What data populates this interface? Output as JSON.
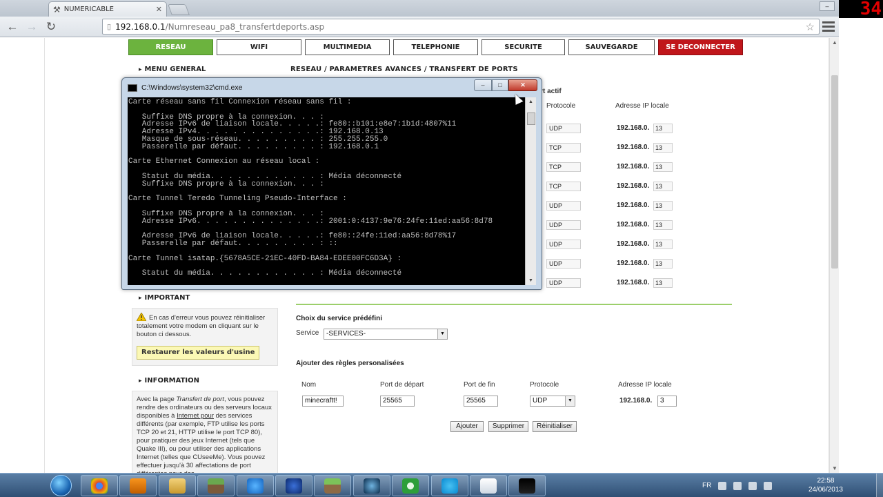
{
  "browser": {
    "tab_title": "NUMERICABLE",
    "url_host": "192.168.0.1",
    "url_path": "/Numreseau_pa8_transfertdeports.asp",
    "recording_counter": "34"
  },
  "router": {
    "nav": [
      {
        "label": "RESEAU",
        "state": "active"
      },
      {
        "label": "WIFI",
        "state": "normal"
      },
      {
        "label": "MULTIMEDIA",
        "state": "normal"
      },
      {
        "label": "TELEPHONIE",
        "state": "normal"
      },
      {
        "label": "SECURITE",
        "state": "normal"
      },
      {
        "label": "SAUVEGARDE",
        "state": "normal"
      },
      {
        "label": "SE DECONNECTER",
        "state": "danger"
      }
    ],
    "sidebar": {
      "menu_general": "MENU GENERAL",
      "important": "IMPORTANT",
      "important_text": "En cas d'erreur vous pouvez réinitialiser totalement votre modem en cliquant sur le bouton ci dessous.",
      "restore_button": "Restaurer les valeurs d'usine",
      "information": "INFORMATION",
      "information_text_1": "Avec la page",
      "information_text_em": "Transfert de port",
      "information_text_2": ", vous pouvez rendre des ordinateurs ou des serveurs locaux disponibles à",
      "information_link": "Internet pour",
      "information_text_3": "des services différents (par exemple, FTP utilise les ports TCP 20 et 21, HTTP utilise le port TCP 80), pour pratiquer des jeux Internet (tels que Quake III), ou pour utiliser des applications Internet (telles que CUseeMe). Vous pouvez effectuer jusqu'à 30 affectations de port différentes pour des"
    },
    "breadcrumb": "RESEAU / PARAMETRES AVANCES / TRANSFERT DE PORTS",
    "rules_table": {
      "partial_header": "ort actif",
      "col_protocol": "Protocole",
      "col_ip": "Adresse IP locale",
      "ip_prefix": "192.168.0.",
      "rows": [
        {
          "protocol": "UDP",
          "ip_suffix": "13"
        },
        {
          "protocol": "TCP",
          "ip_suffix": "13"
        },
        {
          "protocol": "TCP",
          "ip_suffix": "13"
        },
        {
          "protocol": "TCP",
          "ip_suffix": "13"
        },
        {
          "protocol": "UDP",
          "ip_suffix": "13"
        },
        {
          "protocol": "UDP",
          "ip_suffix": "13"
        },
        {
          "protocol": "UDP",
          "ip_suffix": "13"
        },
        {
          "protocol": "UDP",
          "ip_suffix": "13"
        },
        {
          "protocol": "UDP",
          "ip_suffix": "13"
        }
      ]
    },
    "predefined": {
      "title": "Choix du service prédéfini",
      "service_label": "Service",
      "service_value": "-SERVICES-"
    },
    "custom": {
      "title": "Ajouter des règles personalisées",
      "col_name": "Nom",
      "col_start": "Port de départ",
      "col_end": "Port de fin",
      "col_protocol": "Protocole",
      "col_ip": "Adresse IP locale",
      "name_value": "minecraftt!",
      "start_value": "25565",
      "end_value": "25565",
      "protocol_value": "UDP",
      "ip_prefix": "192.168.0.",
      "ip_suffix": "3",
      "btn_add": "Ajouter",
      "btn_delete": "Supprimer",
      "btn_reset": "Réinitialiser"
    }
  },
  "cmd": {
    "title": "C:\\Windows\\system32\\cmd.exe",
    "lines": [
      "Carte réseau sans fil Connexion réseau sans fil :",
      "",
      "   Suffixe DNS propre à la connexion. . . :",
      "   Adresse IPv6 de liaison locale. . . . .: fe80::b101:e8e7:1b1d:4807%11",
      "   Adresse IPv4. . . . . . . . . . . . . .: 192.168.0.13",
      "   Masque de sous-réseau. . . . . . . . . : 255.255.255.0",
      "   Passerelle par défaut. . . . . . . . . : 192.168.0.1",
      "",
      "Carte Ethernet Connexion au réseau local :",
      "",
      "   Statut du média. . . . . . . . . . . . : Média déconnecté",
      "   Suffixe DNS propre à la connexion. . . :",
      "",
      "Carte Tunnel Teredo Tunneling Pseudo-Interface :",
      "",
      "   Suffixe DNS propre à la connexion. . . :",
      "   Adresse IPv6. . . . . . . . . . . . . .: 2001:0:4137:9e76:24fe:11ed:aa56:8d78",
      "",
      "   Adresse IPv6 de liaison locale. . . . .: fe80::24fe:11ed:aa56:8d78%17",
      "   Passerelle par défaut. . . . . . . . . : ::",
      "",
      "Carte Tunnel isatap.{5678A5CE-21EC-40FD-BA84-EDEE00FC6D3A} :",
      "",
      "   Statut du média. . . . . . . . . . . . : Média déconnecté"
    ]
  },
  "taskbar": {
    "language": "FR",
    "time": "22:58",
    "date": "24/06/2013",
    "items": [
      "chrome",
      "media-player",
      "file-explorer",
      "minecraft",
      "internet-explorer",
      "firefox-nightly",
      "minecraft-launcher",
      "steam",
      "utorrent",
      "skype",
      "notepad",
      "cmd"
    ]
  },
  "colors": {
    "nav_active": "#6cb33e",
    "nav_danger": "#c0161b",
    "separator": "#9ccf6b"
  }
}
